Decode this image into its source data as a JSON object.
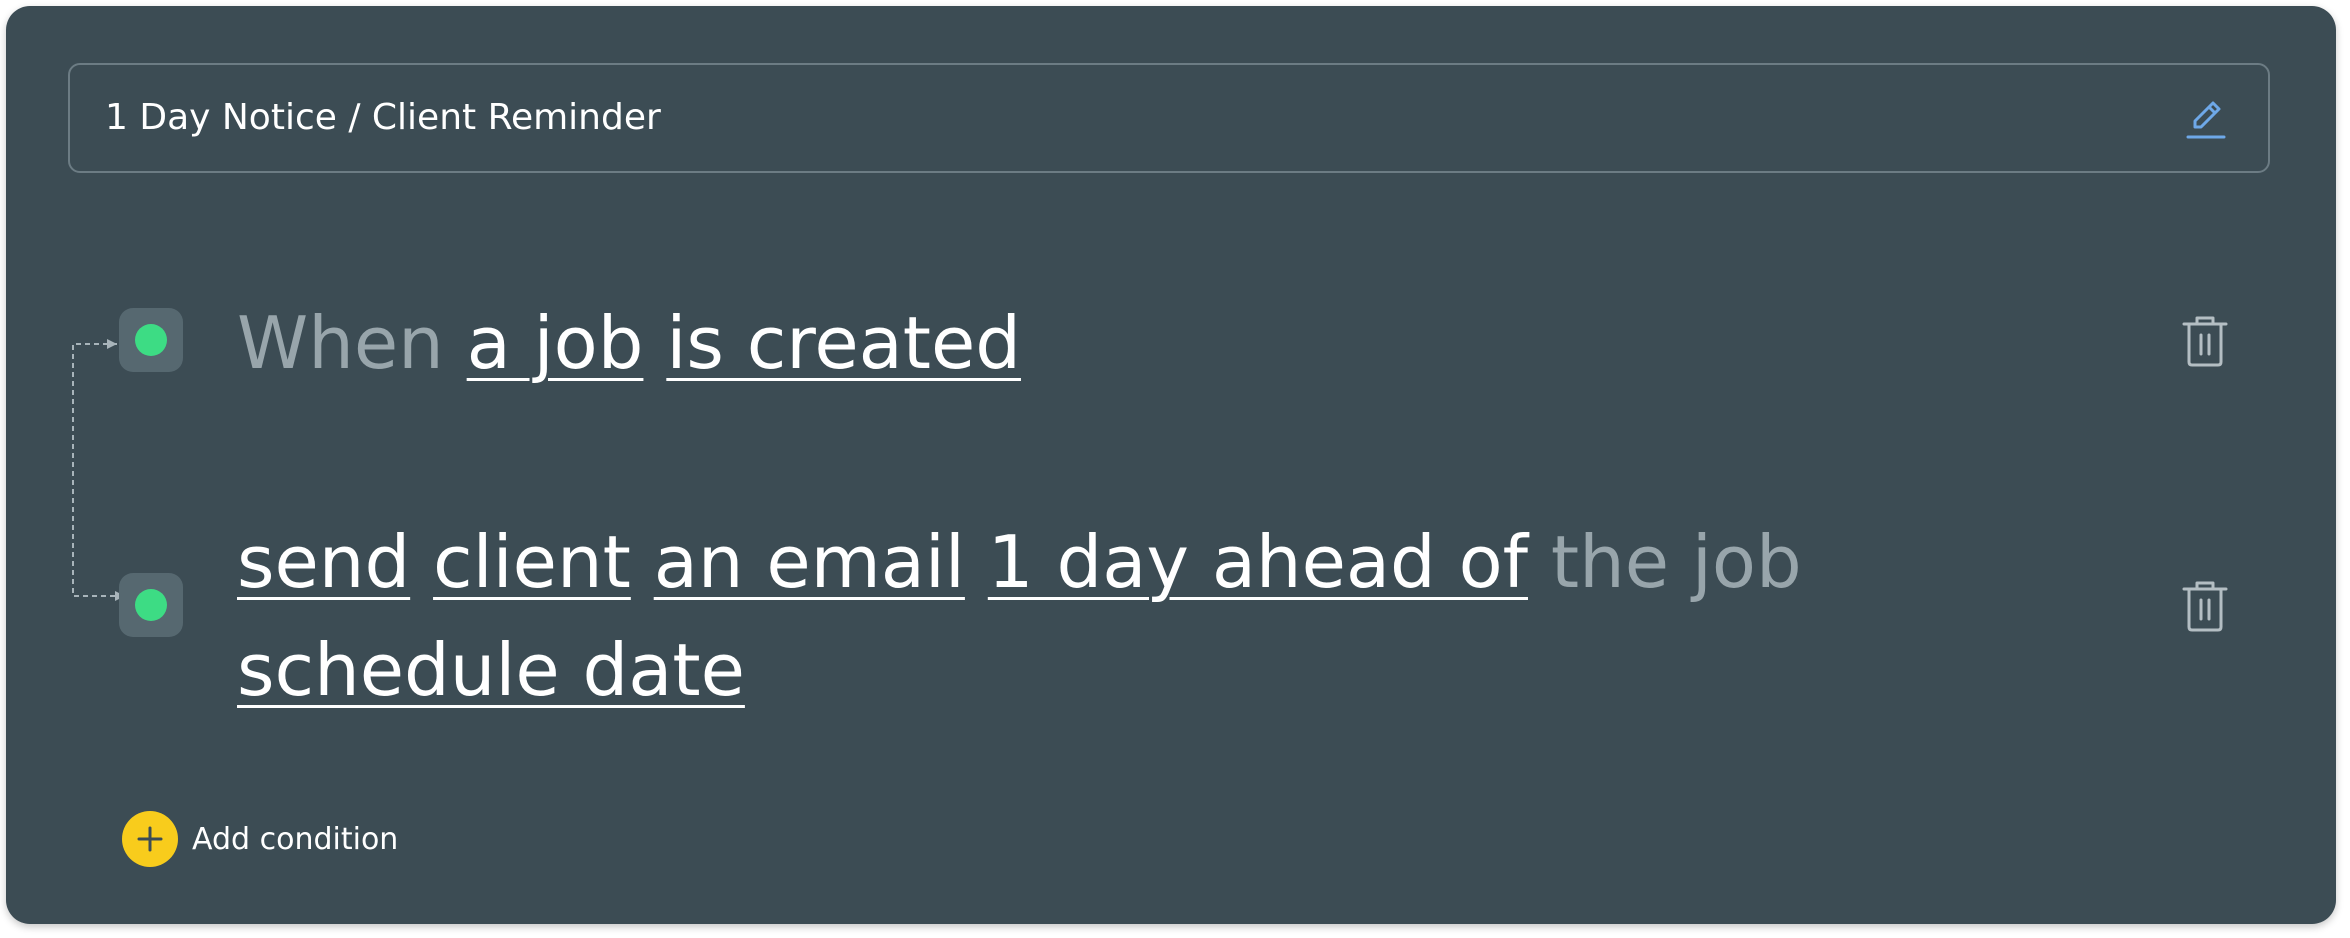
{
  "workflow": {
    "title": "1 Day Notice / Client Reminder",
    "edit_icon": "pencil-icon"
  },
  "trigger": {
    "when": "When",
    "subject": "a job",
    "event": "is created",
    "delete_icon": "trash-icon"
  },
  "action": {
    "verb": "send",
    "recipient": "client",
    "medium": "an email",
    "timing": "1 day ahead of",
    "the_job": "the job",
    "field": "schedule date",
    "delete_icon": "trash-icon"
  },
  "add_condition": {
    "label": "Add condition",
    "icon": "plus-icon"
  },
  "colors": {
    "card_bg": "#3c4c54",
    "node_bg": "#566870",
    "status_dot": "#3ddc84",
    "accent_yellow": "#f8cc1c",
    "edit_icon_blue": "#6ea8e8",
    "muted_text": "#98a5ab"
  }
}
